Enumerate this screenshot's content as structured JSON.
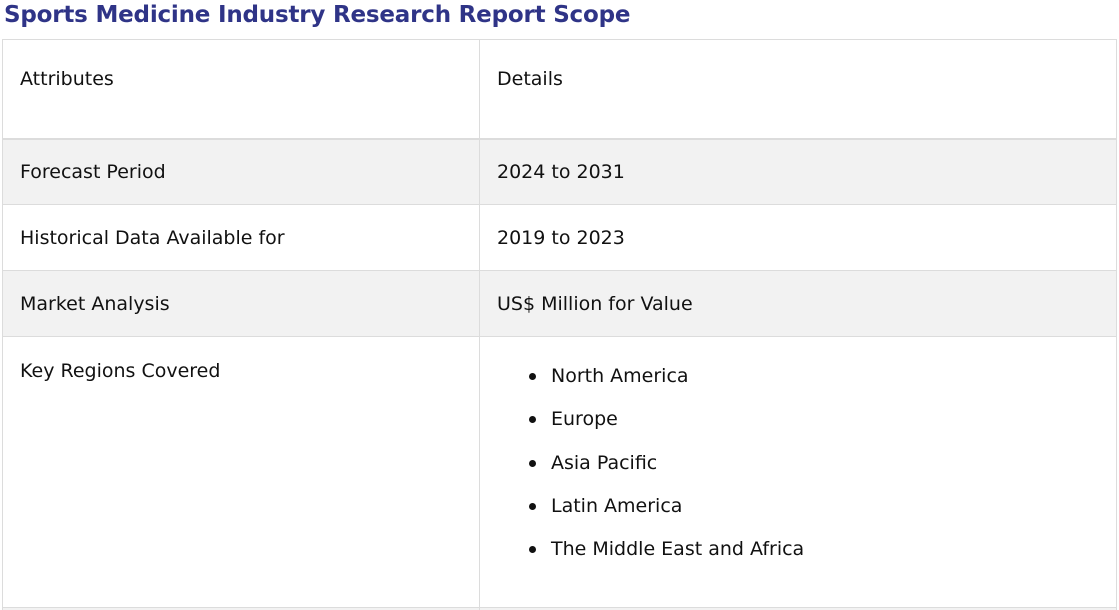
{
  "report": {
    "title": "Sports Medicine Industry Research Report Scope"
  },
  "table": {
    "header": {
      "attribute": "Attributes",
      "details": "Details"
    },
    "rows": [
      {
        "attribute": "Forecast Period",
        "details": "2024 to 2031"
      },
      {
        "attribute": "Historical Data Available for",
        "details": "2019 to 2023"
      },
      {
        "attribute": "Market Analysis",
        "details": "US$ Million for Value"
      }
    ],
    "regions": {
      "attribute": "Key Regions Covered",
      "items": [
        "North America",
        "Europe",
        "Asia Pacific",
        "Latin America",
        "The Middle East and Africa"
      ]
    }
  },
  "colors": {
    "title": "#2f3487",
    "alt_row": "#f2f2f2",
    "border": "#dcdcdc"
  }
}
